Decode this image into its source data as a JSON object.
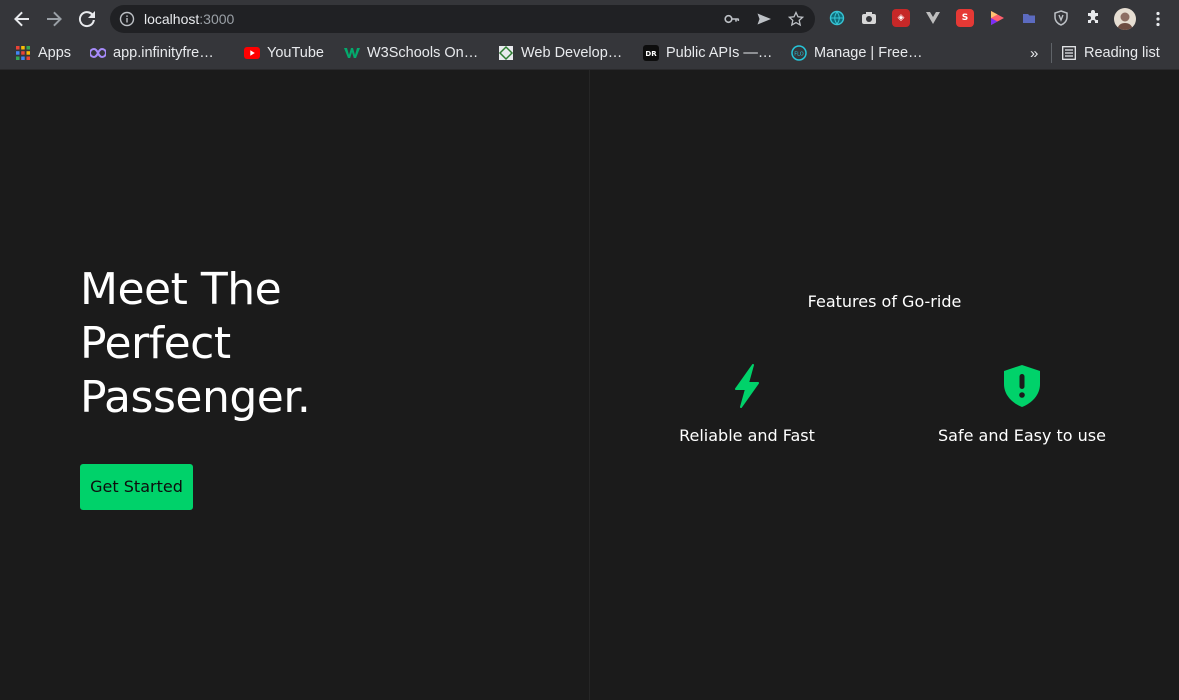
{
  "browser": {
    "url_host": "localhost",
    "url_port": ":3000",
    "reading_list": "Reading list",
    "overflow_chevron": "»"
  },
  "bookmarks": [
    {
      "label": "Apps",
      "icon": "apps-grid-icon"
    },
    {
      "label": "app.infinityfre…",
      "icon": "infinityfree-icon"
    },
    {
      "label": "YouTube",
      "icon": "youtube-icon"
    },
    {
      "label": "W3Schools On…",
      "icon": "w3schools-icon"
    },
    {
      "label": "Web Develop…",
      "icon": "web-develop-icon"
    },
    {
      "label": "Public APIs —…",
      "icon": "dr-icon"
    },
    {
      "label": "Manage | Free…",
      "icon": "flo-icon"
    }
  ],
  "hero": {
    "line1": "Meet The",
    "line2": "Perfect",
    "line3": "Passenger.",
    "cta_label": "Get Started"
  },
  "features": {
    "title": "Features of Go-ride",
    "items": [
      {
        "label": "Reliable and Fast",
        "icon": "lightning-bolt-icon"
      },
      {
        "label": "Safe and Easy to use",
        "icon": "shield-alert-icon"
      }
    ]
  },
  "colors": {
    "accent": "#00d26a",
    "background": "#1b1b1b",
    "chrome": "#35363a",
    "omnibox": "#202124"
  }
}
